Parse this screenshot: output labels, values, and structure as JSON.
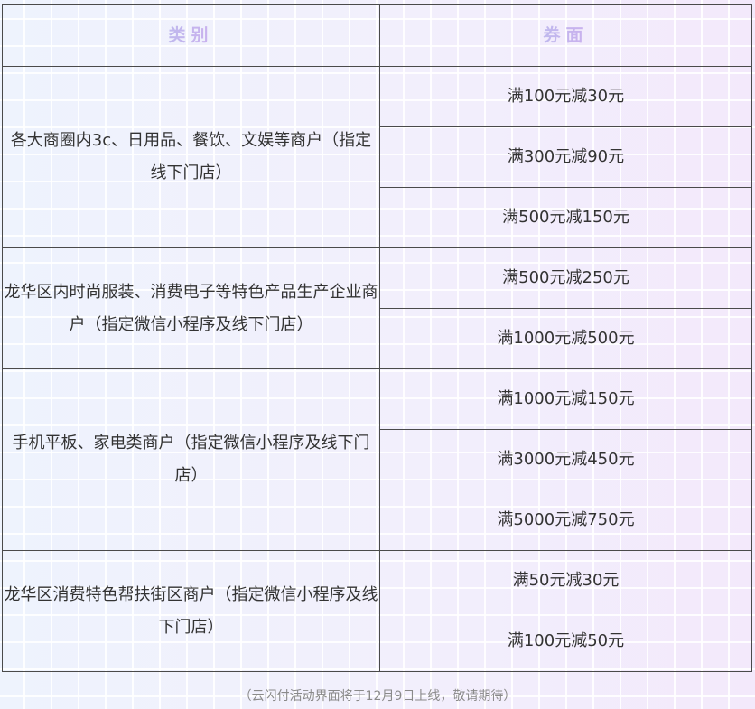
{
  "header": {
    "category": "类别",
    "coupon": "券面"
  },
  "groups": [
    {
      "category": "各大商圈内3c、日用品、餐饮、文娱等商户（指定线下门店）",
      "coupons": [
        "满100元减30元",
        "满300元减90元",
        "满500元减150元"
      ]
    },
    {
      "category": "龙华区内时尚服装、消费电子等特色产品生产企业商户（指定微信小程序及线下门店）",
      "coupons": [
        "满500元减250元",
        "满1000元减500元"
      ]
    },
    {
      "category": "手机平板、家电类商户（指定微信小程序及线下门店）",
      "coupons": [
        "满1000元减150元",
        "满3000元减450元",
        "满5000元减750元"
      ]
    },
    {
      "category": "龙华区消费特色帮扶街区商户（指定微信小程序及线下门店）",
      "coupons": [
        "满50元减30元",
        "满100元减50元"
      ]
    }
  ],
  "footer_note": "（云闪付活动界面将于12月9日上线，敬请期待）"
}
